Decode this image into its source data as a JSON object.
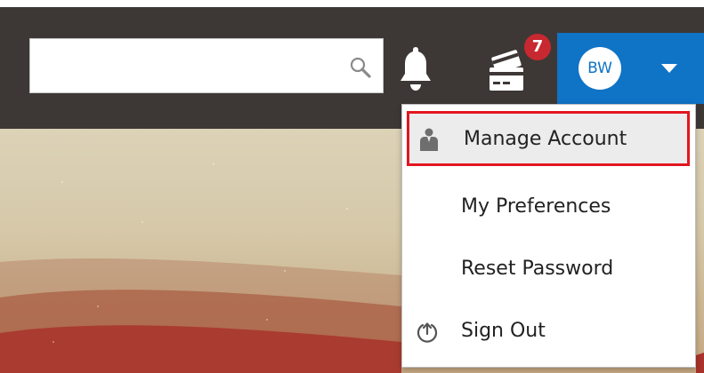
{
  "header": {
    "search": {
      "value": "",
      "placeholder": "",
      "icon": "search-icon"
    },
    "notifications": {
      "icon": "bell-icon"
    },
    "worklist": {
      "icon": "cards-icon",
      "badge_count": "7"
    },
    "user": {
      "initials": "BW",
      "caret_icon": "caret-down-icon"
    }
  },
  "dropdown": {
    "items": [
      {
        "label": "Manage Account",
        "icon": "person-icon",
        "highlighted": true
      },
      {
        "label": "My Preferences"
      },
      {
        "label": "Reset Password"
      },
      {
        "label": "Sign Out",
        "icon": "power-icon"
      }
    ]
  },
  "colors": {
    "topbar": "#3d3836",
    "user_button": "#0f73c6",
    "badge": "#c8282f",
    "highlight_border": "#e2161f"
  }
}
